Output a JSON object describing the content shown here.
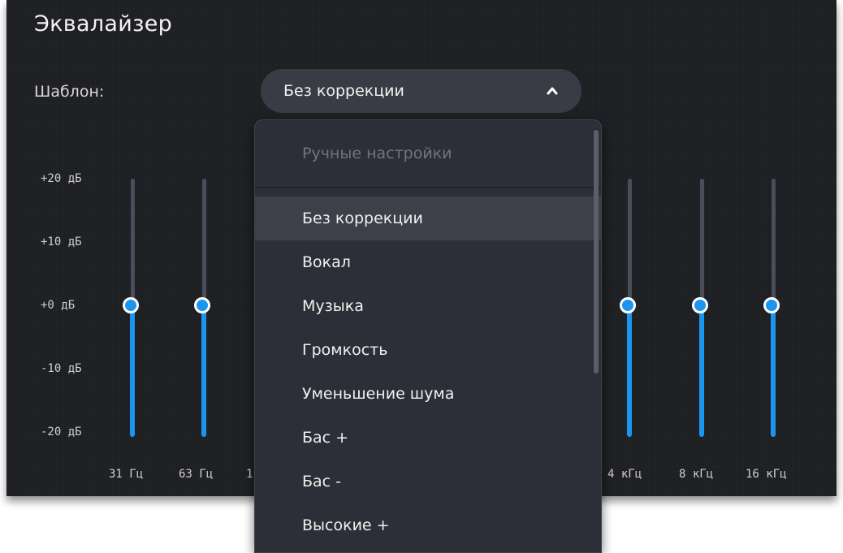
{
  "equalizer": {
    "title": "Эквалайзер",
    "preset_label": "Шаблон:",
    "preset_selected": "Без коррекции",
    "db_scale": [
      "+20 дБ",
      "+10 дБ",
      "+0 дБ",
      "-10 дБ",
      "-20 дБ"
    ],
    "frequencies": [
      "31 Гц",
      "63 Гц",
      "1",
      "4 кГц",
      "8 кГц",
      "16 кГц"
    ],
    "band_gains_db": [
      0,
      0,
      0,
      0,
      0
    ]
  },
  "dropdown": {
    "header": "Ручные настройки",
    "items": [
      "Без коррекции",
      "Вокал",
      "Музыка",
      "Громкость",
      "Уменьшение шума",
      "Бас +",
      "Бас -",
      "Высокие +"
    ],
    "selected_index": 0
  },
  "colors": {
    "accent": "#1a96f0",
    "panel_bg": "#1d1e22",
    "dropdown_bg": "#2d2f38",
    "selected_item_bg": "#3d3f49"
  }
}
